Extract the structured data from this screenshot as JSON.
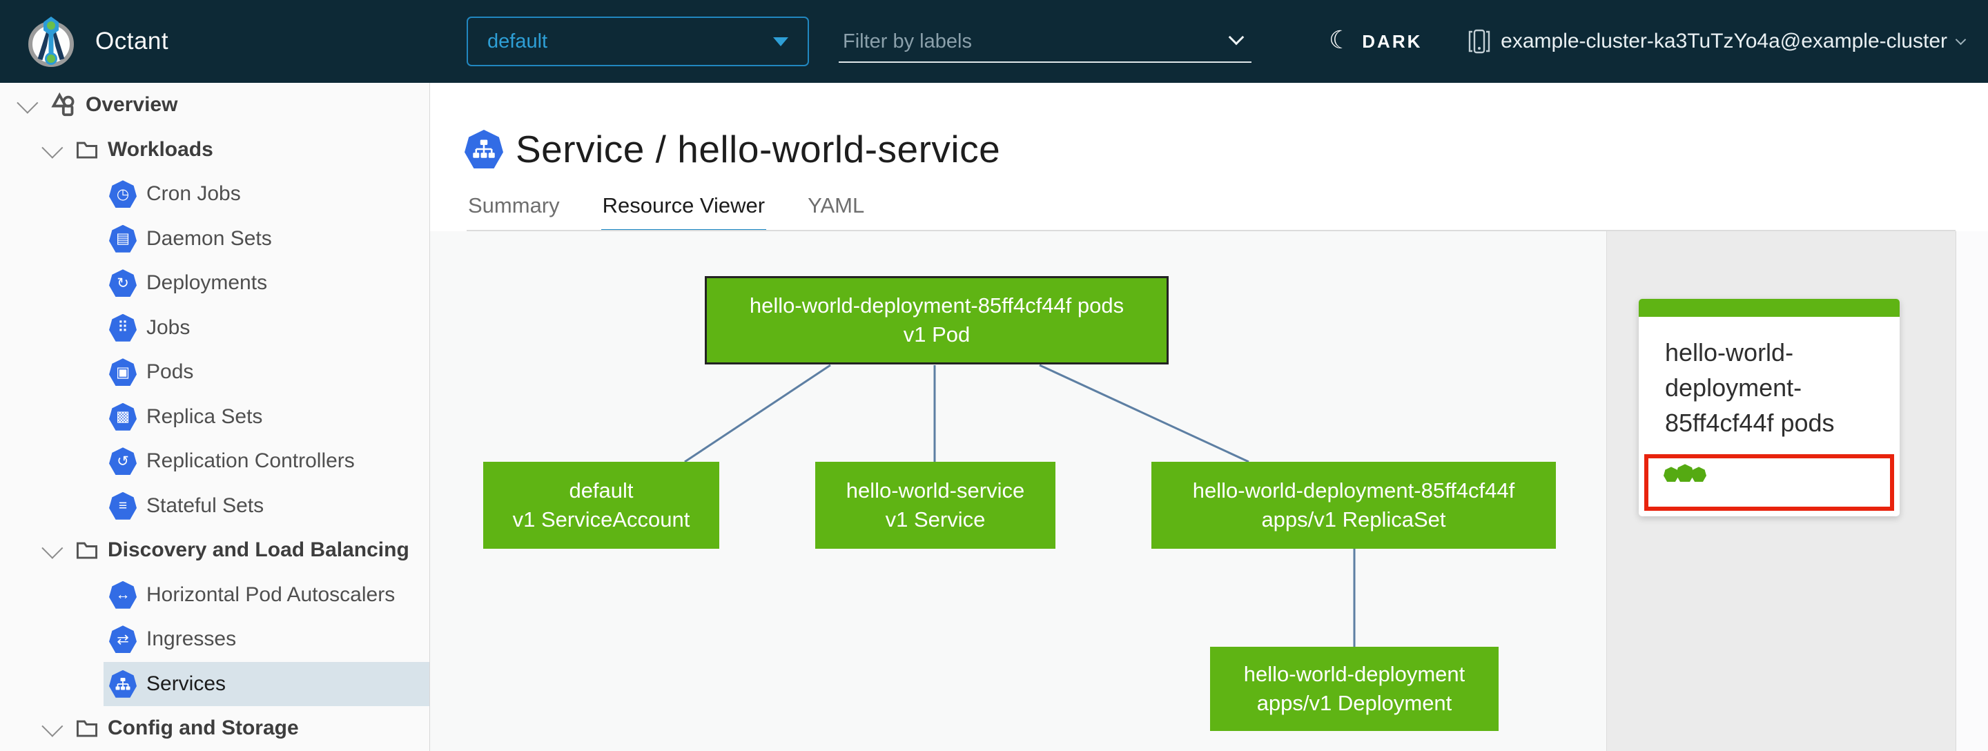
{
  "header": {
    "app_title": "Octant",
    "namespace_dropdown": {
      "value": "default"
    },
    "filter_input": {
      "placeholder": "Filter by labels",
      "value": ""
    },
    "theme_toggle": {
      "label": "DARK"
    },
    "cluster_context": {
      "value": "example-cluster-ka3TuTzYo4a@example-cluster"
    }
  },
  "sidebar": {
    "items": [
      {
        "label": "Overview",
        "level": 0,
        "selected": false
      },
      {
        "label": "Workloads",
        "level": 1,
        "selected": false
      },
      {
        "label": "Cron Jobs",
        "level": 2,
        "selected": false
      },
      {
        "label": "Daemon Sets",
        "level": 2,
        "selected": false
      },
      {
        "label": "Deployments",
        "level": 2,
        "selected": false
      },
      {
        "label": "Jobs",
        "level": 2,
        "selected": false
      },
      {
        "label": "Pods",
        "level": 2,
        "selected": false
      },
      {
        "label": "Replica Sets",
        "level": 2,
        "selected": false
      },
      {
        "label": "Replication Controllers",
        "level": 2,
        "selected": false
      },
      {
        "label": "Stateful Sets",
        "level": 2,
        "selected": false
      },
      {
        "label": "Discovery and Load Balancing",
        "level": 1,
        "selected": false
      },
      {
        "label": "Horizontal Pod Autoscalers",
        "level": 2,
        "selected": false
      },
      {
        "label": "Ingresses",
        "level": 2,
        "selected": false
      },
      {
        "label": "Services",
        "level": 2,
        "selected": true
      },
      {
        "label": "Config and Storage",
        "level": 1,
        "selected": false
      }
    ]
  },
  "icons": {
    "cron_jobs": "◷",
    "daemon_sets": "▤",
    "deployments": "↻",
    "jobs": "⠿",
    "pods": "▣",
    "replica_sets": "▩",
    "replication_controllers": "↺",
    "stateful_sets": "≡",
    "horizontal_pod_autoscalers": "↔",
    "ingresses": "⇄",
    "moon": "☾"
  },
  "main": {
    "title": "Service / hello-world-service",
    "tabs": [
      {
        "label": "Summary",
        "active": false
      },
      {
        "label": "Resource Viewer",
        "active": true
      },
      {
        "label": "YAML",
        "active": false
      }
    ]
  },
  "graph": {
    "nodes": [
      {
        "name": "hello-world-deployment-85ff4cf44f pods",
        "kind": "v1 Pod",
        "status": "ok",
        "selected": true
      },
      {
        "name": "default",
        "kind": "v1 ServiceAccount",
        "status": "ok",
        "selected": false
      },
      {
        "name": "hello-world-service",
        "kind": "v1 Service",
        "status": "ok",
        "selected": false
      },
      {
        "name": "hello-world-deployment-85ff4cf44f",
        "kind": "apps/v1 ReplicaSet",
        "status": "ok",
        "selected": false
      },
      {
        "name": "hello-world-deployment",
        "kind": "apps/v1 Deployment",
        "status": "ok",
        "selected": false
      }
    ],
    "edges": [
      {
        "from": "pod",
        "to": "serviceaccount"
      },
      {
        "from": "pod",
        "to": "service"
      },
      {
        "from": "pod",
        "to": "replicaset"
      },
      {
        "from": "replicaset",
        "to": "deployment"
      }
    ]
  },
  "side_card": {
    "title": "hello-world-deployment-85ff4cf44f pods",
    "pod_count": 3
  },
  "colors": {
    "header_bg": "#0d2936",
    "accent_blue": "#2e9fd6",
    "k8s_icon_blue": "#326ce5",
    "node_green": "#5fb414",
    "edge_blue": "#5d7fa3",
    "tab_active_blue": "#1786c4",
    "selected_nav_bg": "#d8e3ea",
    "alert_red": "#e8230d",
    "panel_bg": "#ebebeb"
  }
}
